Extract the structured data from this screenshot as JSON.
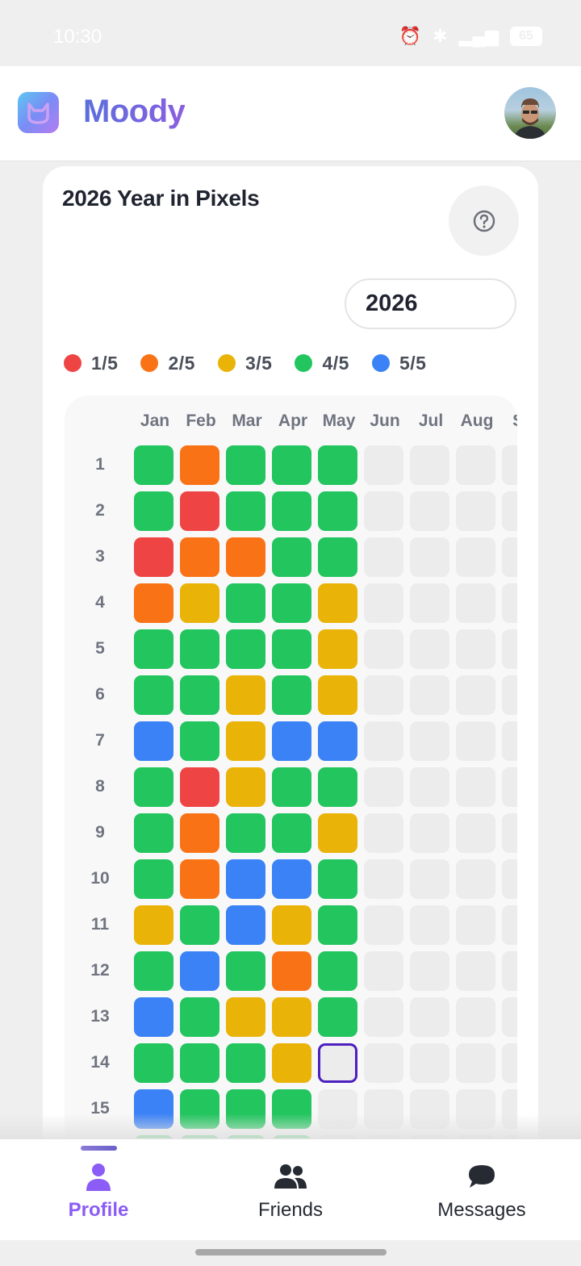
{
  "status_bar": {
    "time": "10:30",
    "battery": "65"
  },
  "header": {
    "app_name": "Moody",
    "logo_icon": "moody-logo-icon",
    "avatar_icon": "user-avatar"
  },
  "card": {
    "title": "2026 Year in Pixels",
    "help_icon": "question-circle-icon",
    "year_select": {
      "selected": "2026"
    },
    "legend": [
      {
        "label": "1/5",
        "color": "#ef4444"
      },
      {
        "label": "2/5",
        "color": "#f97316"
      },
      {
        "label": "3/5",
        "color": "#eab308"
      },
      {
        "label": "4/5",
        "color": "#22c55e"
      },
      {
        "label": "5/5",
        "color": "#3b82f6"
      }
    ]
  },
  "pixels": {
    "months": [
      "Jan",
      "Feb",
      "Mar",
      "Apr",
      "May",
      "Jun",
      "Jul",
      "Aug",
      "Se"
    ],
    "days": [
      "1",
      "2",
      "3",
      "4",
      "5",
      "6",
      "7",
      "8",
      "9",
      "10",
      "11",
      "12",
      "13",
      "14",
      "15"
    ],
    "empty_color": "#ececec",
    "today": {
      "day": 14,
      "month": 5
    },
    "moods": [
      [
        4,
        2,
        4,
        4,
        4,
        0,
        0,
        0,
        0
      ],
      [
        4,
        1,
        4,
        4,
        4,
        0,
        0,
        0,
        0
      ],
      [
        1,
        2,
        2,
        4,
        4,
        0,
        0,
        0,
        0
      ],
      [
        2,
        3,
        4,
        4,
        3,
        0,
        0,
        0,
        0
      ],
      [
        4,
        4,
        4,
        4,
        3,
        0,
        0,
        0,
        0
      ],
      [
        4,
        4,
        3,
        4,
        3,
        0,
        0,
        0,
        0
      ],
      [
        5,
        4,
        3,
        5,
        5,
        0,
        0,
        0,
        0
      ],
      [
        4,
        1,
        3,
        4,
        4,
        0,
        0,
        0,
        0
      ],
      [
        4,
        2,
        4,
        4,
        3,
        0,
        0,
        0,
        0
      ],
      [
        4,
        2,
        5,
        5,
        4,
        0,
        0,
        0,
        0
      ],
      [
        3,
        4,
        5,
        3,
        4,
        0,
        0,
        0,
        0
      ],
      [
        4,
        5,
        4,
        2,
        4,
        0,
        0,
        0,
        0
      ],
      [
        5,
        4,
        3,
        3,
        4,
        0,
        0,
        0,
        0
      ],
      [
        4,
        4,
        4,
        3,
        0,
        0,
        0,
        0,
        0
      ],
      [
        5,
        4,
        4,
        4,
        0,
        0,
        0,
        0,
        0
      ],
      [
        4,
        4,
        4,
        4,
        0,
        0,
        0,
        0,
        0
      ]
    ]
  },
  "bottom_nav": {
    "items": [
      {
        "label": "Profile",
        "icon": "person-icon",
        "active": true
      },
      {
        "label": "Friends",
        "icon": "people-icon",
        "active": false
      },
      {
        "label": "Messages",
        "icon": "chat-bubble-icon",
        "active": false
      }
    ]
  }
}
